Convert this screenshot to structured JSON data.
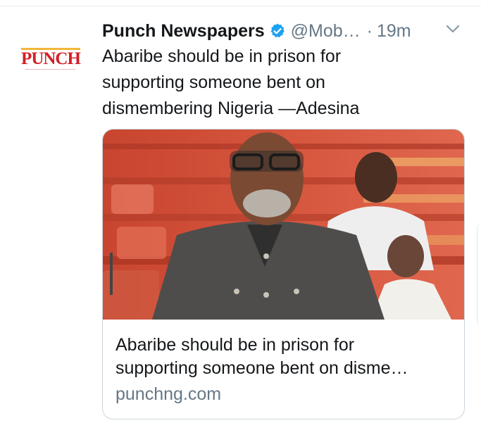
{
  "tweet": {
    "author_name": "Punch Newspapers",
    "handle": "@Mob…",
    "separator": "·",
    "time": "19m",
    "text_lines": [
      "Abaribe should be in prison for",
      "supporting someone bent on",
      "dismembering Nigeria —Adesina"
    ]
  },
  "avatar": {
    "logo_text": "PUNCH"
  },
  "card": {
    "title_lines": [
      "Abaribe should be in prison for",
      "supporting someone bent on disme…"
    ],
    "domain": "punchng.com"
  },
  "colors": {
    "verified": "#1da1f2",
    "muted": "#657786",
    "text": "#14171a",
    "punch_red": "#d21f26",
    "punch_gold": "#f2b63c"
  },
  "icons": {
    "verified": "verified-badge-icon",
    "menu": "chevron-down-icon"
  }
}
